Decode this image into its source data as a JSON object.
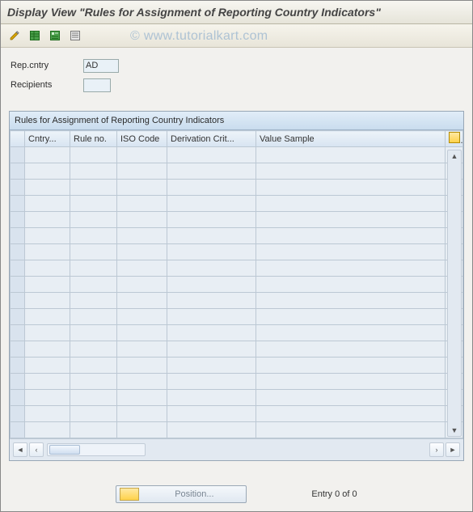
{
  "title": "Display View \"Rules for Assignment of Reporting Country Indicators\"",
  "watermark": "© www.tutorialkart.com",
  "toolbar": {
    "icons": [
      "change-icon",
      "table-view-icon",
      "table-detail-icon",
      "table-list-icon"
    ]
  },
  "form": {
    "rep_cntry": {
      "label": "Rep.cntry",
      "value": "AD"
    },
    "recipients": {
      "label": "Recipients",
      "value": ""
    }
  },
  "table": {
    "title": "Rules for Assignment of Reporting Country Indicators",
    "columns": [
      "Cntry...",
      "Rule no.",
      "ISO Code",
      "Derivation Crit...",
      "Value Sample"
    ],
    "rows": [
      [
        "",
        "",
        "",
        "",
        ""
      ],
      [
        "",
        "",
        "",
        "",
        ""
      ],
      [
        "",
        "",
        "",
        "",
        ""
      ],
      [
        "",
        "",
        "",
        "",
        ""
      ],
      [
        "",
        "",
        "",
        "",
        ""
      ],
      [
        "",
        "",
        "",
        "",
        ""
      ],
      [
        "",
        "",
        "",
        "",
        ""
      ],
      [
        "",
        "",
        "",
        "",
        ""
      ],
      [
        "",
        "",
        "",
        "",
        ""
      ],
      [
        "",
        "",
        "",
        "",
        ""
      ],
      [
        "",
        "",
        "",
        "",
        ""
      ],
      [
        "",
        "",
        "",
        "",
        ""
      ],
      [
        "",
        "",
        "",
        "",
        ""
      ],
      [
        "",
        "",
        "",
        "",
        ""
      ],
      [
        "",
        "",
        "",
        "",
        ""
      ],
      [
        "",
        "",
        "",
        "",
        ""
      ],
      [
        "",
        "",
        "",
        "",
        ""
      ],
      [
        "",
        "",
        "",
        "",
        ""
      ]
    ]
  },
  "footer": {
    "position_label": "Position...",
    "entry_text": "Entry 0 of 0"
  }
}
